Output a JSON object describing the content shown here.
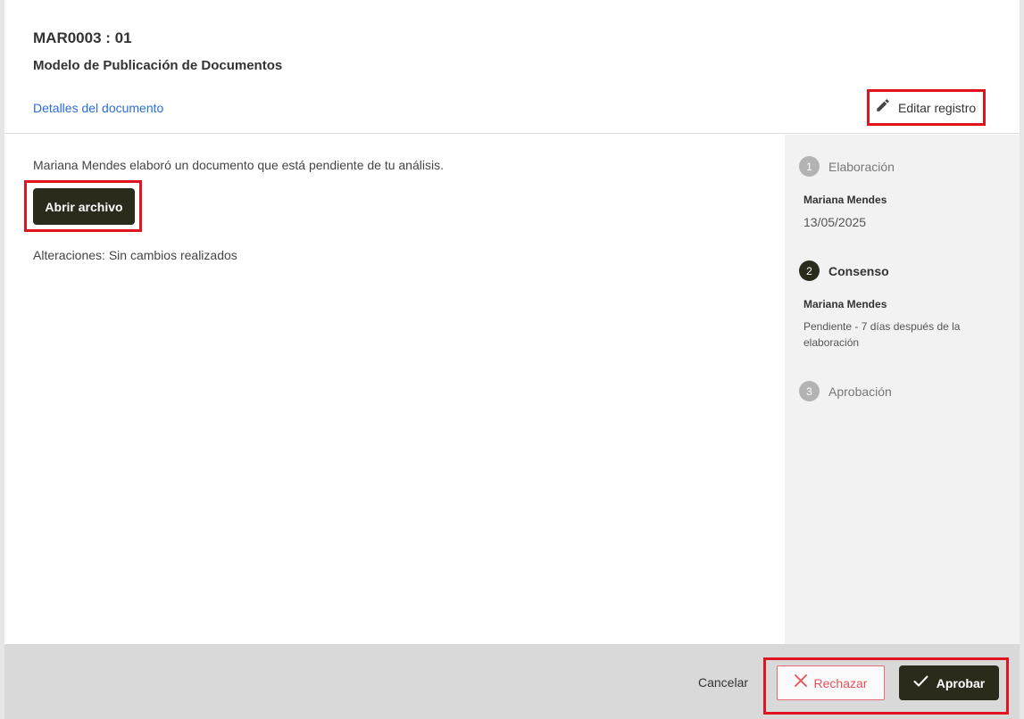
{
  "header": {
    "doc_code": "MAR0003 : 01",
    "doc_title": "Modelo de Publicación de Documentos",
    "details_link": "Detalles del documento",
    "edit_label": "Editar registro"
  },
  "main": {
    "info_text": "Mariana Mendes elaboró un documento que está pendiente de tu análisis.",
    "open_file_label": "Abrir archivo",
    "changes_text": "Alteraciones: Sin cambios realizados"
  },
  "workflow": {
    "steps": [
      {
        "number": "1",
        "name": "Elaboración",
        "active": false,
        "user": "Mariana Mendes",
        "date": "13/05/2025"
      },
      {
        "number": "2",
        "name": "Consenso",
        "active": true,
        "user": "Mariana Mendes",
        "status": "Pendiente - 7 días después de la elaboración"
      },
      {
        "number": "3",
        "name": "Aprobación",
        "active": false
      }
    ]
  },
  "footer": {
    "cancel_label": "Cancelar",
    "reject_label": "Rechazar",
    "approve_label": "Aprobar"
  },
  "colors": {
    "primary_dark": "#2b2b1c",
    "link_blue": "#2a6ed8",
    "reject_red": "#e8505a",
    "highlight_red": "#e0141e"
  },
  "icons": {
    "edit": "pencil-icon",
    "reject": "close-icon",
    "approve": "checkmark-icon"
  }
}
